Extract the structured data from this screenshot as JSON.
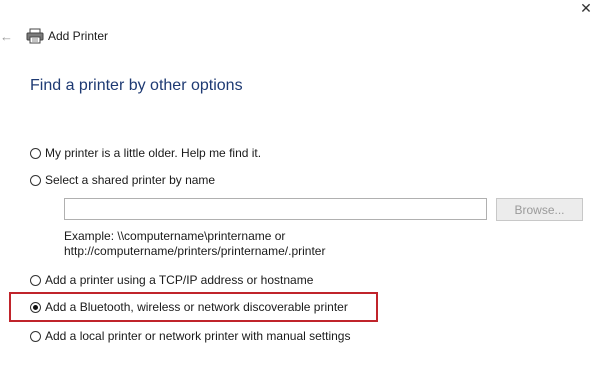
{
  "window": {
    "title": "Add Printer",
    "close_glyph": "✕",
    "back_glyph": "←",
    "icons": {
      "back": "back-arrow-icon",
      "printer": "printer-icon",
      "close": "close-icon"
    }
  },
  "heading": "Find a printer by other options",
  "options": [
    {
      "label": "My printer is a little older. Help me find it.",
      "selected": false
    },
    {
      "label": "Select a shared printer by name",
      "selected": false
    },
    {
      "label": "Add a printer using a TCP/IP address or hostname",
      "selected": false
    },
    {
      "label": "Add a Bluetooth, wireless or network discoverable printer",
      "selected": true
    },
    {
      "label": "Add a local printer or network printer with manual settings",
      "selected": false
    }
  ],
  "shared_printer": {
    "input_value": "",
    "browse_label": "Browse...",
    "example_line1": "Example: \\\\computername\\printername or",
    "example_line2": "http://computername/printers/printername/.printer"
  },
  "colors": {
    "heading": "#1e3a73",
    "highlight_border": "#c0242b"
  }
}
